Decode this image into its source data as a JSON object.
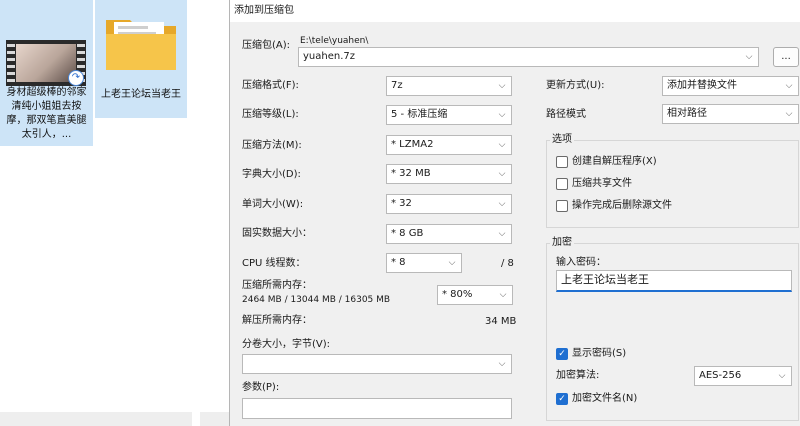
{
  "desktop": {
    "file1_name": "身材超级棒的邻家清纯小姐姐去按摩，那双笔直美腿太引人，...",
    "file2_name": "上老王论坛当老王"
  },
  "dialog": {
    "title": "添加到压缩包",
    "archive_label": "压缩包(A):",
    "archive_path": "E:\\tele\\yuahen\\",
    "archive_name": "yuahen.7z",
    "browse_label": "...",
    "format_label": "压缩格式(F):",
    "format_value": "7z",
    "level_label": "压缩等级(L):",
    "level_value": "5 - 标准压缩",
    "method_label": "压缩方法(M):",
    "method_value": "* LZMA2",
    "dict_label": "字典大小(D):",
    "dict_value": "* 32 MB",
    "word_label": "单词大小(W):",
    "word_value": "* 32",
    "solid_label": "固实数据大小：",
    "solid_value": "* 8 GB",
    "threads_label": "CPU 线程数：",
    "threads_value": "* 8",
    "threads_total": "/ 8",
    "mem_comp_label": "压缩所需内存：",
    "mem_comp_detail": "2464 MB / 13044 MB / 16305 MB",
    "mem_comp_value": "* 80%",
    "mem_decomp_label": "解压所需内存：",
    "mem_decomp_value": "34 MB",
    "split_label": "分卷大小，字节(V):",
    "split_value": "",
    "params_label": "参数(P):",
    "params_value": "",
    "update_label": "更新方式(U):",
    "update_value": "添加并替换文件",
    "pathmode_label": "路径模式",
    "pathmode_value": "相对路径",
    "options_title": "选项",
    "opt_sfx": "创建自解压程序(X)",
    "opt_shared": "压缩共享文件",
    "opt_delete": "操作完成后删除源文件",
    "encrypt_title": "加密",
    "pw_label": "输入密码：",
    "pw_value": "上老王论坛当老王",
    "show_pw": "显示密码(S)",
    "enc_method_label": "加密算法:",
    "enc_method_value": "AES-256",
    "enc_names": "加密文件名(N)"
  },
  "colors": {
    "accent": "#1f6fd1",
    "selection": "#cde4f7",
    "dialog_bg": "#f0f0f0"
  }
}
